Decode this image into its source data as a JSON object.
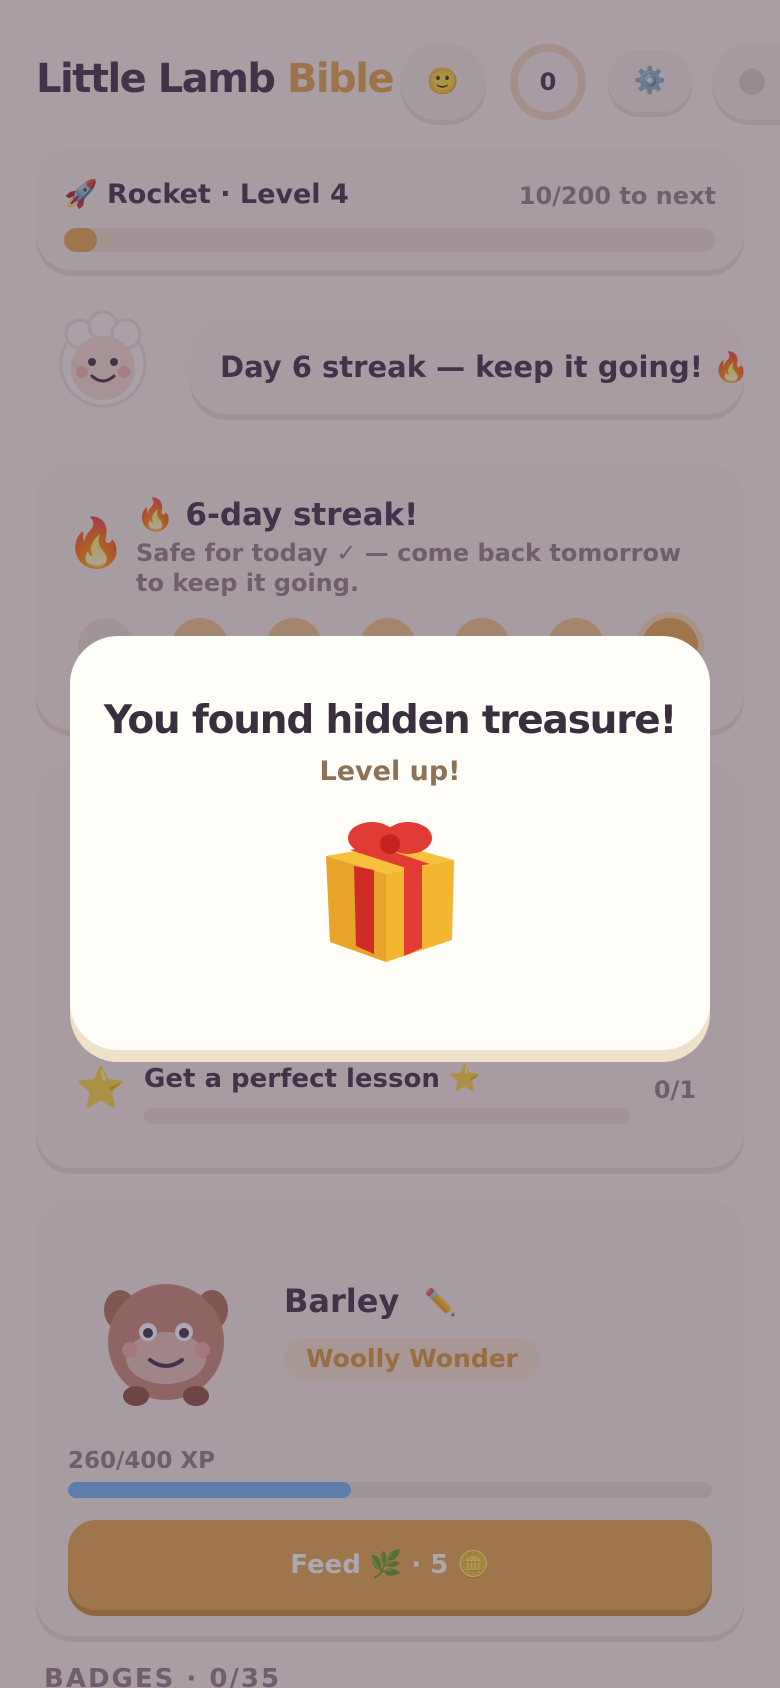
{
  "header": {
    "title_part1": "Little Lamb",
    "title_part2": "Bible",
    "face_icon": "🙂",
    "coin_count": "0",
    "gear_icon": "⚙️"
  },
  "level": {
    "label": "🚀  Rocket · Level 4",
    "progress_text": "10/200 to next",
    "progress_fraction": 0.05
  },
  "mascot": {
    "message": "Day 6 streak — keep it going! 🔥"
  },
  "streak": {
    "flame": "🔥",
    "title": "🔥  6-day streak!",
    "subtitle": "Safe for today ✓ — come back tomorrow to keep it going."
  },
  "quests": {
    "star": "⭐",
    "item_label": "Get a perfect lesson ⭐",
    "item_count": "0/1",
    "item_progress": 0
  },
  "pet": {
    "name": "Barley",
    "edit_icon": "✏️",
    "title": "Woolly Wonder",
    "xp_text": "260/400 XP",
    "xp_fraction": 0.44,
    "feed_label": "Feed 🌿 · 5 🪙"
  },
  "badges": {
    "heading": "BADGES · 0/35"
  },
  "modal": {
    "title": "You found hidden treasure!",
    "subtitle": "Level up!"
  }
}
